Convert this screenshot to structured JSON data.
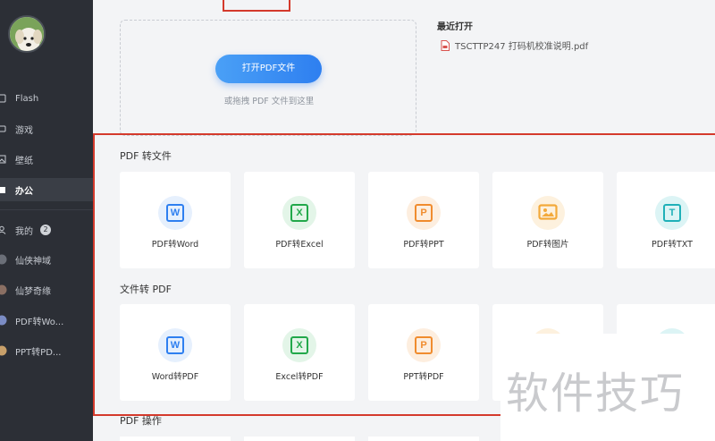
{
  "sidebar": {
    "items": [
      {
        "label": "Flash",
        "icon": "flash-icon"
      },
      {
        "label": "游戏",
        "icon": "gamepad-icon"
      },
      {
        "label": "壁纸",
        "icon": "wallpaper-icon"
      },
      {
        "label": "办公",
        "icon": "office-icon",
        "active": true
      },
      {
        "label": "我的",
        "icon": "user-icon",
        "badge": "2"
      },
      {
        "label": "仙侠神域",
        "icon": "game-avatar-icon"
      },
      {
        "label": "仙梦奇缘",
        "icon": "game-avatar-icon"
      },
      {
        "label": "PDF转Wo...",
        "icon": "app-avatar-icon"
      },
      {
        "label": "PPT转PD...",
        "icon": "app-avatar-icon"
      }
    ]
  },
  "dropzone": {
    "button_label": "打开PDF文件",
    "hint": "或拖拽 PDF 文件到这里"
  },
  "recent": {
    "title": "最近打开",
    "files": [
      "TSCTTP247 打码机校准说明.pdf"
    ]
  },
  "sections": [
    {
      "title": "PDF 转文件",
      "cards": [
        {
          "label": "PDF转Word",
          "letter": "W",
          "color": "#2e7ff0",
          "bg": "#e6f0fd"
        },
        {
          "label": "PDF转Excel",
          "letter": "X",
          "color": "#22a84a",
          "bg": "#e3f5e8"
        },
        {
          "label": "PDF转PPT",
          "letter": "P",
          "color": "#f08c2e",
          "bg": "#fdeedf"
        },
        {
          "label": "PDF转图片",
          "letter": "",
          "color": "#f3a93a",
          "bg": "#fdf1de"
        },
        {
          "label": "PDF转TXT",
          "letter": "T",
          "color": "#1fb0b8",
          "bg": "#dcf4f5"
        }
      ]
    },
    {
      "title": "文件转 PDF",
      "cards": [
        {
          "label": "Word转PDF",
          "letter": "W",
          "color": "#2e7ff0",
          "bg": "#e6f0fd"
        },
        {
          "label": "Excel转PDF",
          "letter": "X",
          "color": "#22a84a",
          "bg": "#e3f5e8"
        },
        {
          "label": "PPT转PDF",
          "letter": "P",
          "color": "#f08c2e",
          "bg": "#fdeedf"
        }
      ]
    },
    {
      "title": "PDF 操作"
    }
  ],
  "watermark": "软件技巧"
}
